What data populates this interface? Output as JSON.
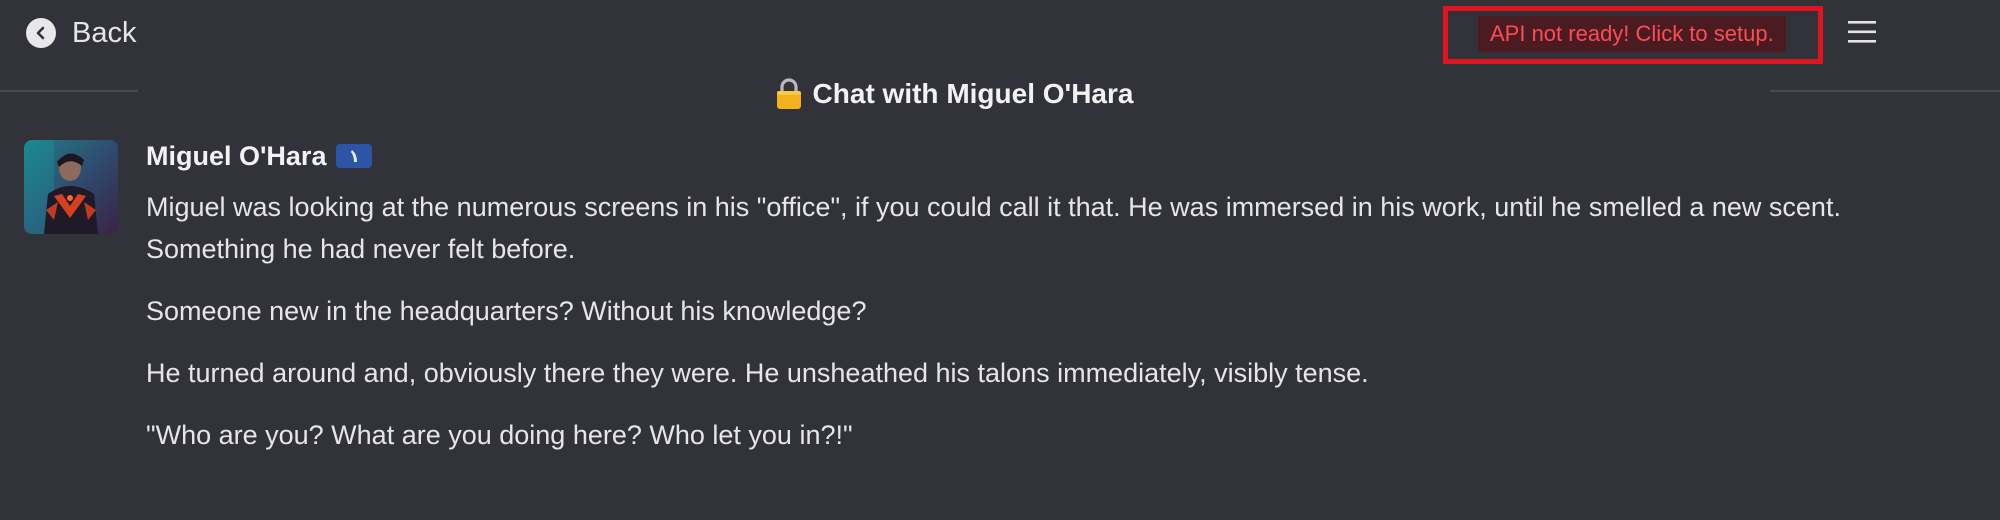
{
  "topbar": {
    "back_label": "Back",
    "api_status": "API not ready! Click to setup.",
    "highlight_color": "#e0141e",
    "api_status_color": "#ff4b55"
  },
  "header": {
    "title": "Chat with Miguel O'Hara",
    "lock_icon": "lock-icon"
  },
  "message": {
    "sender": "Miguel O'Hara",
    "badge_icon": "bot-badge-icon",
    "paragraphs": [
      "Miguel was looking at the numerous screens in his \"office\", if you could call it that. He was immersed in his work, until he smelled a new scent. Something he had never felt before.",
      "Someone new in the headquarters? Without his knowledge?",
      "He turned around and, obviously there they were. He unsheathed his talons immediately, visibly tense.",
      "\"Who are you? What are you doing here? Who let you in?!\""
    ]
  },
  "theme": {
    "background": "#32333a",
    "text": "#e6e6e8",
    "badge": "#2c55a8"
  }
}
